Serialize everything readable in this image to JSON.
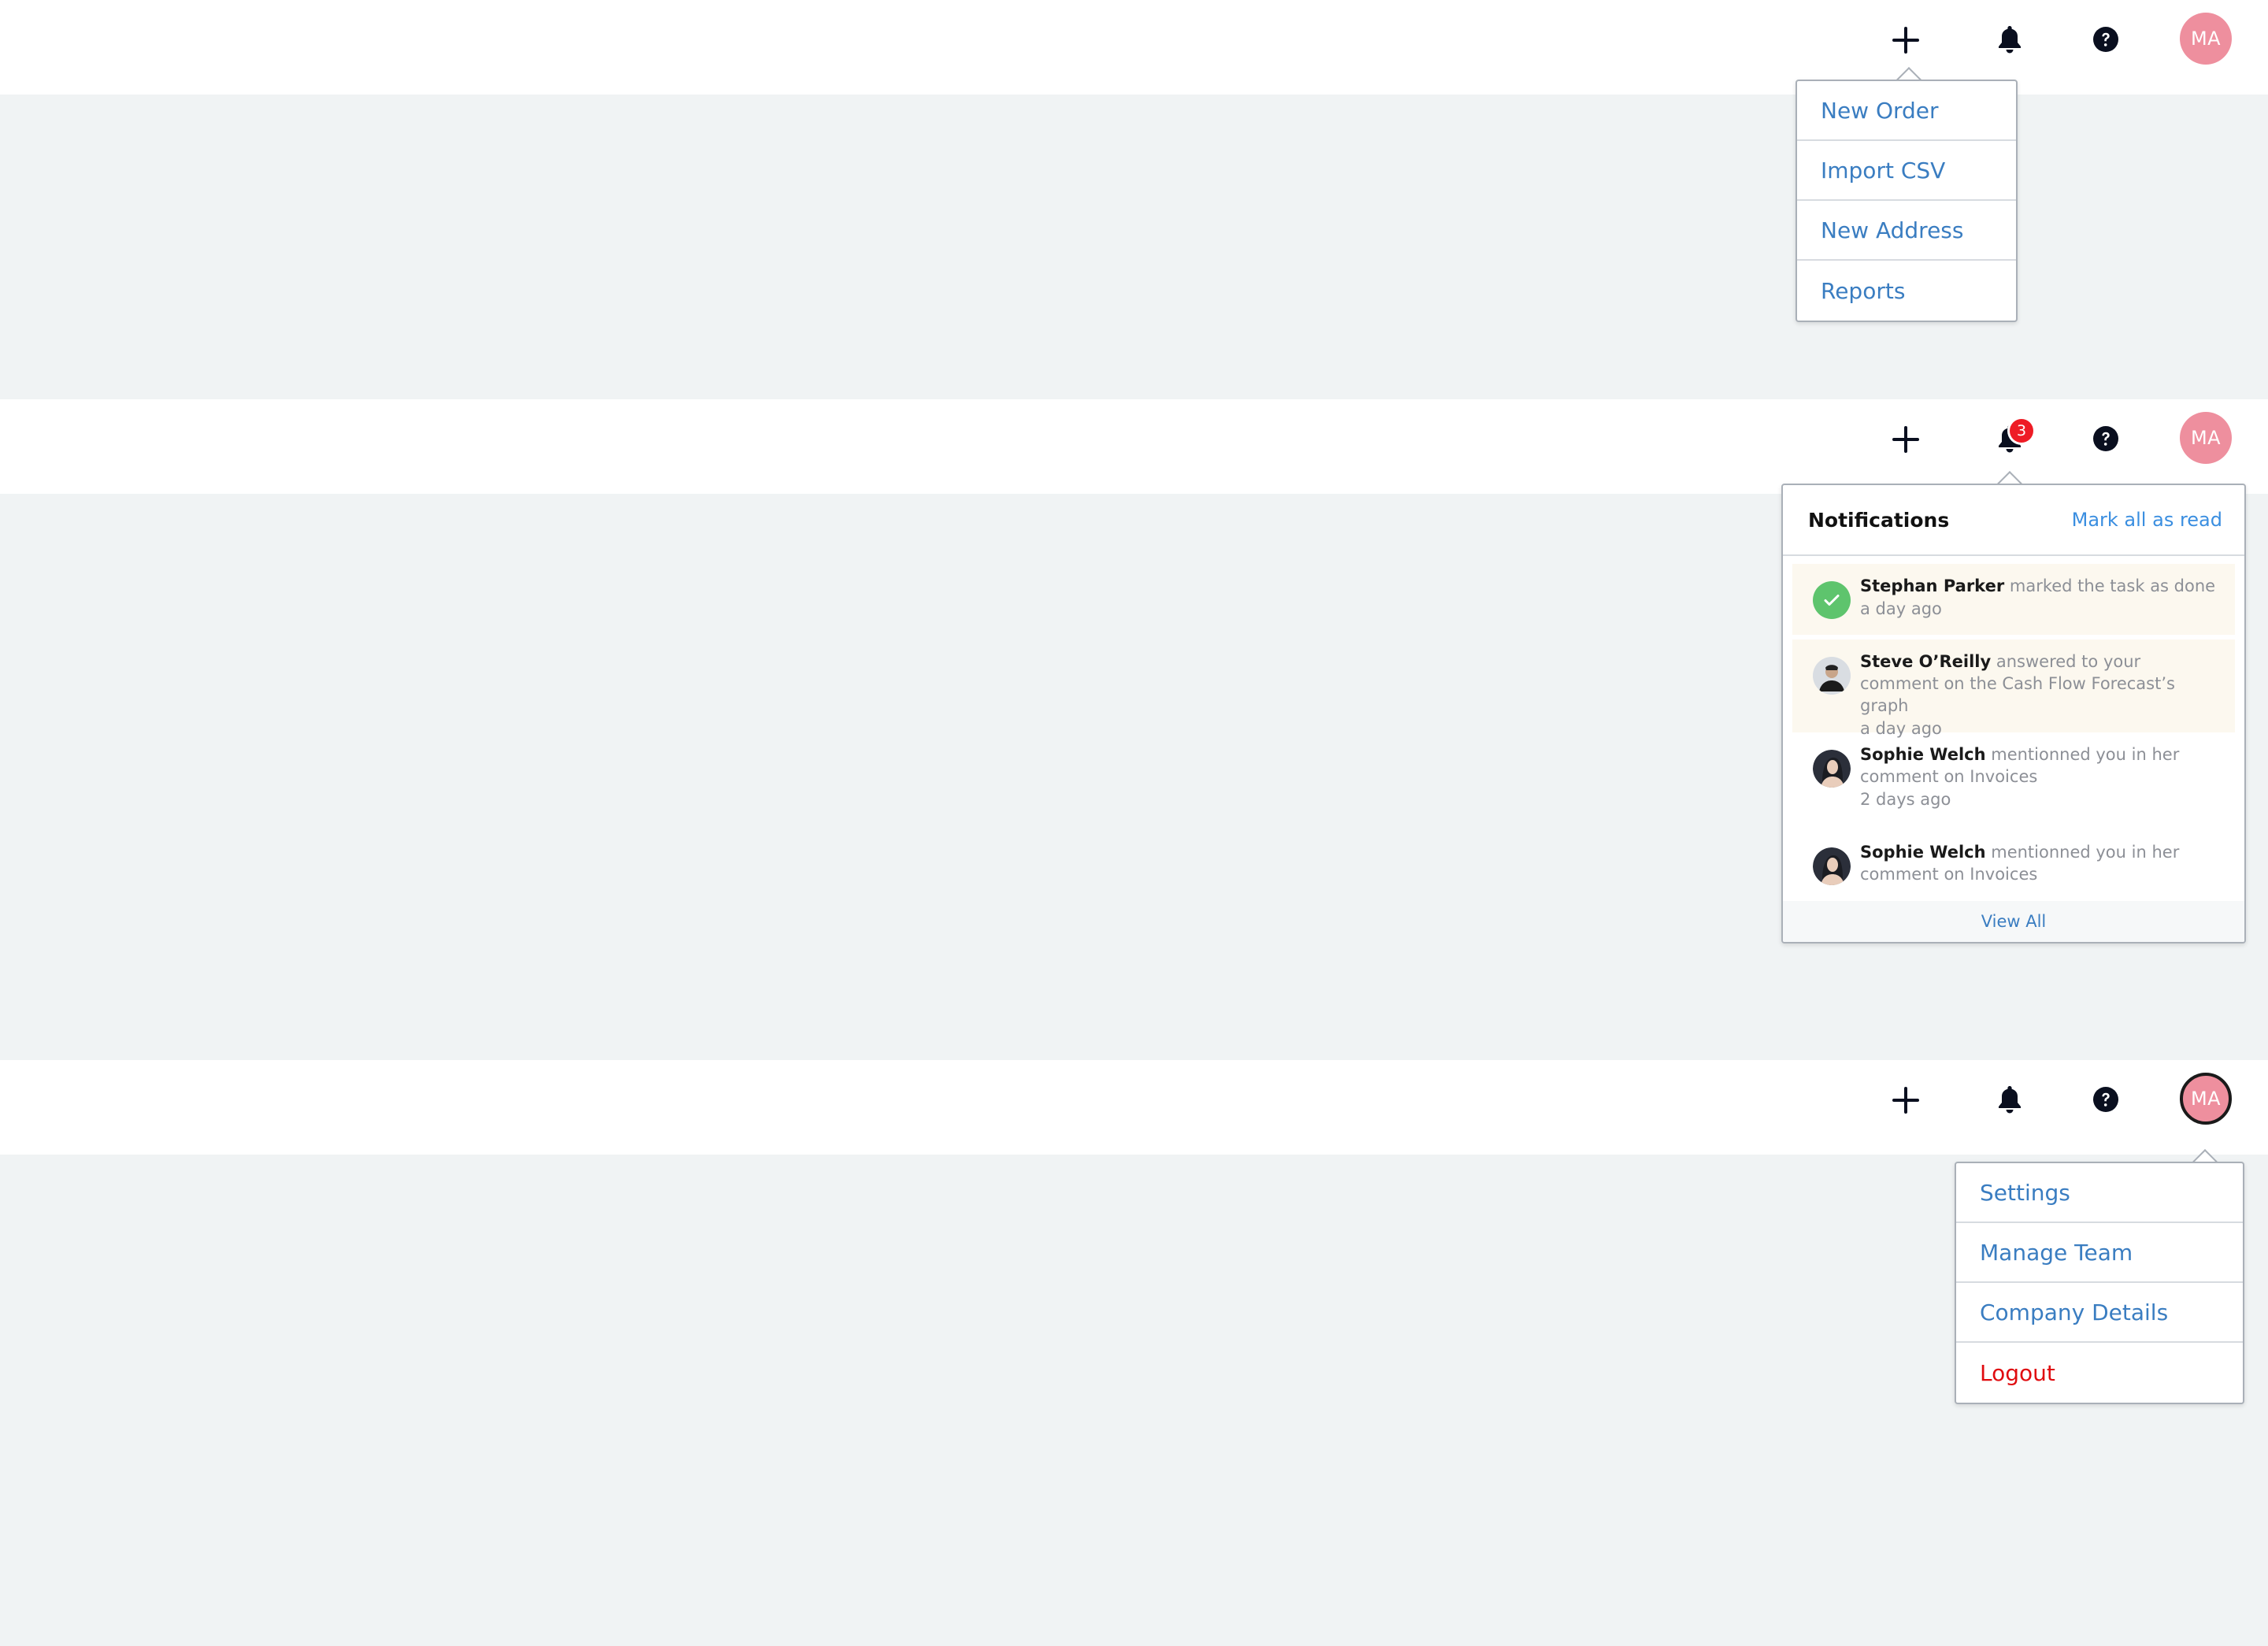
{
  "avatar_initials": "MA",
  "notification_count": "3",
  "add_menu": {
    "items": [
      "New Order",
      "Import CSV",
      "New Address",
      "Reports"
    ]
  },
  "notifications": {
    "title": "Notifications",
    "mark_all": "Mark all as read",
    "view_all": "View All",
    "items": [
      {
        "name": "Stephan Parker",
        "text": "marked the task as done",
        "time": "a day ago"
      },
      {
        "name": "Steve O’Reilly",
        "text": "answered to your comment on the Cash Flow Forecast’s graph",
        "time": "a day ago"
      },
      {
        "name": "Sophie Welch",
        "text": "mentionned you in her comment on Invoices",
        "time": "2 days ago"
      },
      {
        "name": "Sophie Welch",
        "text": "mentionned you in her comment on Invoices",
        "time": ""
      }
    ]
  },
  "user_menu": {
    "items": [
      "Settings",
      "Manage Team",
      "Company Details"
    ],
    "logout": "Logout"
  },
  "colors": {
    "accent": "#3a7dc1",
    "avatar": "#ee8f9e",
    "badge": "#ee1c25",
    "logout": "#e00c10",
    "background": "#f0f3f4"
  }
}
